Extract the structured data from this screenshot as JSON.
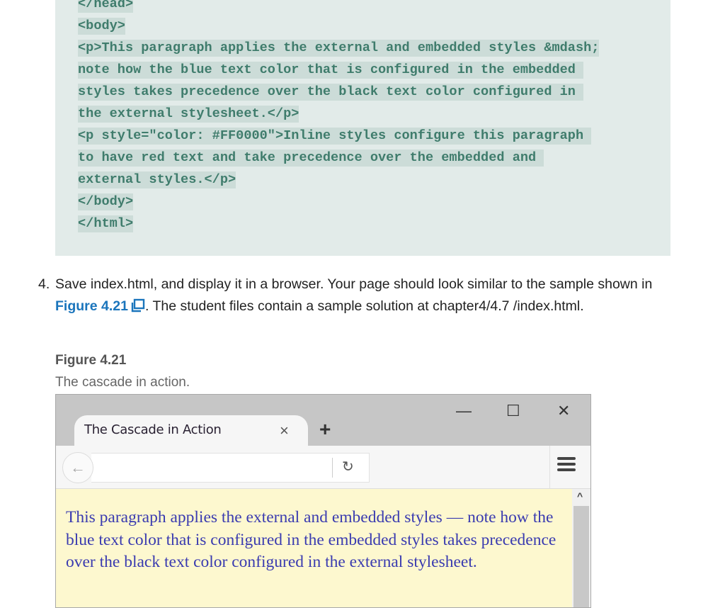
{
  "code_block": {
    "lines": [
      "</head>",
      "<body>",
      "<p>This paragraph applies the external and embedded styles &mdash;",
      "note how the blue text color that is configured in the embedded ",
      "styles takes precedence over the black text color configured in ",
      "the external stylesheet.</p>",
      "<p style=\"color: #FF0000\">Inline styles configure this paragraph ",
      "to have red text and take precedence over the embedded and ",
      "external styles.</p>",
      "</body>",
      "</html>"
    ]
  },
  "step": {
    "number": "4.",
    "text_before": "Save index.html, and display it in a browser. Your page should look similar to the sample shown in ",
    "figure_link": "Figure 4.21",
    "text_after": ". The student files contain a sample solution at chapter4/4.7 /index.html."
  },
  "figure": {
    "title": "Figure 4.21",
    "caption": "The cascade in action."
  },
  "browser": {
    "tab_title": "The Cascade in Action",
    "tab_close": "×",
    "new_tab": "+",
    "minimize": "—",
    "maximize": "☐",
    "close": "✕",
    "back": "←",
    "reload": "↻",
    "scroll_up": "^",
    "page_text": "This paragraph applies the external and embedded styles — note how the blue text color that is configured in the embedded styles takes precedence over the black text color configured in the external stylesheet."
  }
}
